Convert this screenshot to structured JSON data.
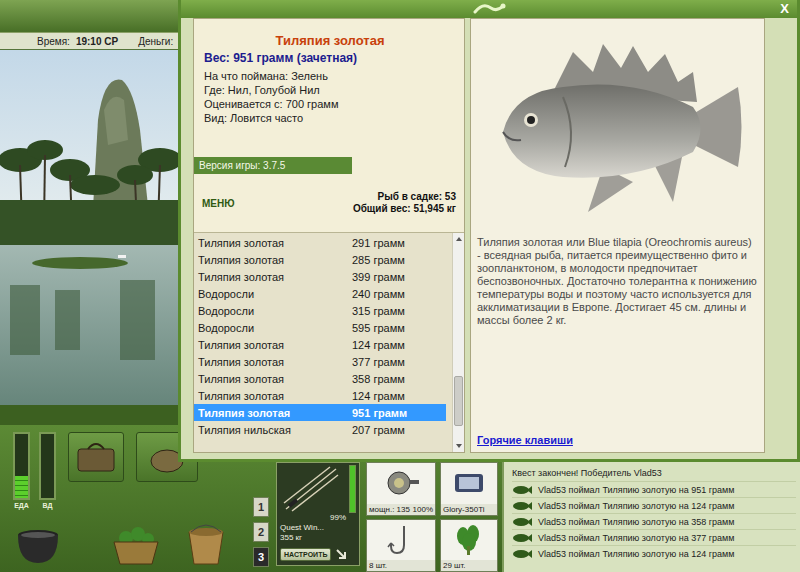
{
  "hud": {
    "time_label": "Время:",
    "time": "19:10 СР",
    "money_label": "Деньги:"
  },
  "gauges": [
    {
      "label": "ЕДА",
      "level": 0.35
    },
    {
      "label": "ВД",
      "level": 0
    }
  ],
  "pages": [
    {
      "label": "1",
      "selected": false
    },
    {
      "label": "2",
      "selected": false
    },
    {
      "label": "3",
      "selected": true
    }
  ],
  "tackle": {
    "rod": {
      "name": "Quest Win...",
      "weight": "355 кг",
      "condition": "99%",
      "level": 0.99,
      "button": "НАСТРОИТЬ"
    },
    "reel": {
      "power": "мощн.: 135",
      "condition": "100%"
    },
    "line": {
      "name": "Glory-350Ti"
    },
    "hooks": {
      "count": "8 шт."
    },
    "bait": {
      "count": "29 шт."
    }
  },
  "log": {
    "title": "Квест закончен! Победитель Vlad53",
    "entries": [
      "Vlad53 поймал Тиляпию золотую на 951 грамм",
      "Vlad53 поймал Тиляпию золотую на 124 грамм",
      "Vlad53 поймал Тиляпию золотую на 358 грамм",
      "Vlad53 поймал Тиляпию золотую на 377 грамм",
      "Vlad53 поймал Тиляпию золотую на 124 грамм"
    ]
  },
  "dialog": {
    "close": "X",
    "card": {
      "title": "Тиляпия золотая",
      "weight": "Вес: 951 грамм (зачетная)",
      "fields": [
        "На что поймана: Зелень",
        "Где: Нил, Голубой Нил",
        "Оценивается с: 700 грамм",
        "Вид: Ловится часто"
      ]
    },
    "version": "Версия игры: 3.7.5",
    "menu": "МЕНЮ",
    "stats": [
      "Рыб в садке: 53",
      "Общий вес: 51,945 кг"
    ],
    "list": [
      {
        "name": "Тиляпия золотая",
        "weight": "291 грамм",
        "selected": false
      },
      {
        "name": "Тиляпия золотая",
        "weight": "285 грамм",
        "selected": false
      },
      {
        "name": "Тиляпия золотая",
        "weight": "399 грамм",
        "selected": false
      },
      {
        "name": "Водоросли",
        "weight": "240 грамм",
        "selected": false
      },
      {
        "name": "Водоросли",
        "weight": "315 грамм",
        "selected": false
      },
      {
        "name": "Водоросли",
        "weight": "595 грамм",
        "selected": false
      },
      {
        "name": "Тиляпия золотая",
        "weight": "124 грамм",
        "selected": false
      },
      {
        "name": "Тиляпия золотая",
        "weight": "377 грамм",
        "selected": false
      },
      {
        "name": "Тиляпия золотая",
        "weight": "358 грамм",
        "selected": false
      },
      {
        "name": "Тиляпия золотая",
        "weight": "124 грамм",
        "selected": false
      },
      {
        "name": "Тиляпия золотая",
        "weight": "951 грамм",
        "selected": true
      },
      {
        "name": "Тиляпия нильская",
        "weight": "207 грамм",
        "selected": false
      }
    ],
    "scroll": {
      "level": 0.9
    },
    "description": "Тиляпия золотая или Blue tilapia (Oreochromis aureus) - всеядная рыба, питается преимущественно фито и зоопланктоном, в молодости предпочитает беспозвоночных. Достаточно толерантна к понижению температуры воды и поэтому часто используется для акклиматизации в Европе. Достигает 45 см. длины и массы более 2 кг.",
    "hotkeys": "Горячие клавиши"
  }
}
